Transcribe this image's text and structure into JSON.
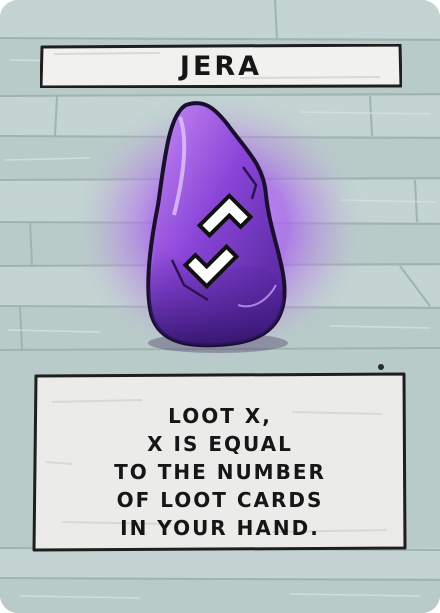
{
  "card": {
    "title": "JERA",
    "description_lines": [
      "LOOT X,",
      "X IS EQUAL",
      "TO THE NUMBER",
      "OF LOOT CARDS",
      "IN YOUR HAND."
    ],
    "rune_color": "#8a3fd8",
    "glow_color": "#b36cf5",
    "background_color": "#b9cbc9"
  }
}
